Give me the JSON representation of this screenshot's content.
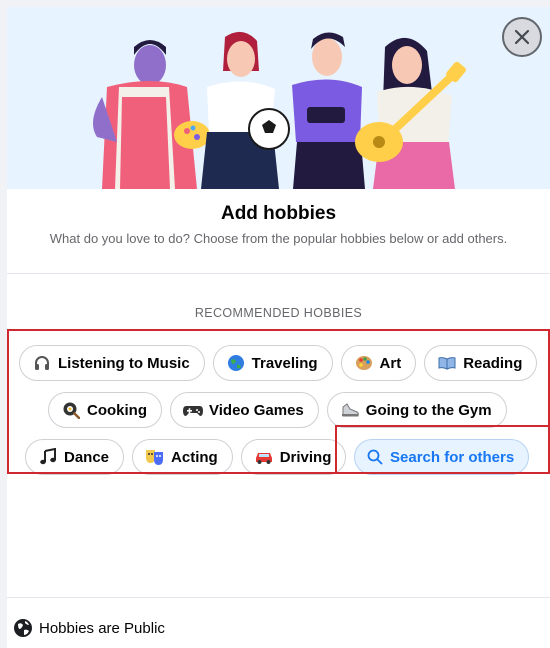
{
  "dialog": {
    "close_icon": "close-icon",
    "title": "Add hobbies",
    "subtitle": "What do you love to do? Choose from the popular hobbies below or add others.",
    "section_label": "RECOMMENDED HOBBIES",
    "hobbies_row1": [
      {
        "label": "Listening to Music",
        "icon": "headphones-icon"
      },
      {
        "label": "Traveling",
        "icon": "globe-icon"
      },
      {
        "label": "Art",
        "icon": "palette-icon"
      },
      {
        "label": "Reading",
        "icon": "book-icon"
      }
    ],
    "hobbies_row2": [
      {
        "label": "Cooking",
        "icon": "frying-pan-icon"
      },
      {
        "label": "Video Games",
        "icon": "game-controller-icon"
      },
      {
        "label": "Going to the Gym",
        "icon": "sneaker-icon"
      }
    ],
    "hobbies_row3": [
      {
        "label": "Dance",
        "icon": "music-note-icon"
      },
      {
        "label": "Acting",
        "icon": "theater-masks-icon"
      },
      {
        "label": "Driving",
        "icon": "car-icon"
      }
    ],
    "search_label": "Search for others",
    "privacy_label": "Hobbies are Public",
    "colors": {
      "accent": "#1877f2",
      "highlight_outline": "#d0282f"
    }
  }
}
